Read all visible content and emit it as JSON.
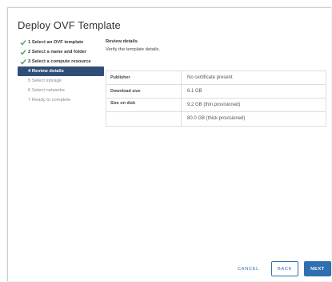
{
  "dialog": {
    "title": "Deploy OVF Template"
  },
  "steps": [
    {
      "label": "1 Select an OVF template",
      "state": "done"
    },
    {
      "label": "2 Select a name and folder",
      "state": "done"
    },
    {
      "label": "3 Select a compute resource",
      "state": "done"
    },
    {
      "label": "4 Review details",
      "state": "active"
    },
    {
      "label": "5 Select storage",
      "state": "pending"
    },
    {
      "label": "6 Select networks",
      "state": "pending"
    },
    {
      "label": "7 Ready to complete",
      "state": "pending"
    }
  ],
  "main": {
    "section_title": "Review details",
    "section_subtitle": "Verify the template details.",
    "details": {
      "publisher_label": "Publisher",
      "publisher_value": "No certificate present",
      "download_label": "Download size",
      "download_value": "6.1 GB",
      "disk_label": "Size on disk",
      "disk_value_thin": "9.2 GB (thin provisioned)",
      "disk_value_thick": "80.0 GB (thick provisioned)"
    }
  },
  "footer": {
    "cancel_label": "CANCEL",
    "back_label": "BACK",
    "next_label": "NEXT"
  },
  "colors": {
    "accent": "#2f6fb0",
    "active_step_bg": "#2f4f76",
    "check_green": "#3d9a4a"
  },
  "icons": {
    "step_done": "check-icon"
  }
}
